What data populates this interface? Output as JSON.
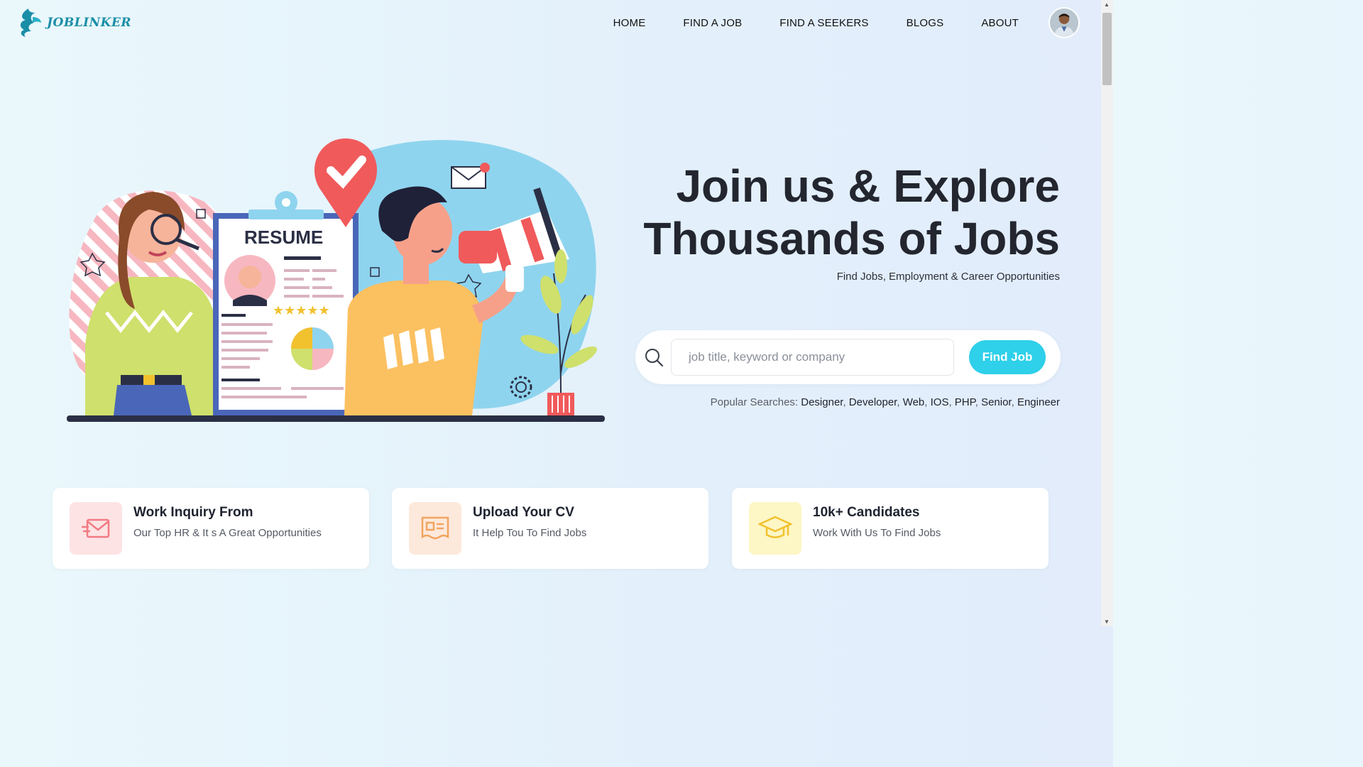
{
  "brand": {
    "name": "JOBLINKER",
    "accent": "#1a8ea6"
  },
  "nav": {
    "items": [
      {
        "label": "HOME"
      },
      {
        "label": "FIND A JOB"
      },
      {
        "label": "FIND A SEEKERS"
      },
      {
        "label": "BLOGS"
      },
      {
        "label": "ABOUT"
      }
    ]
  },
  "hero": {
    "title_line1": "Join us & Explore",
    "title_line2": "Thousands of Jobs",
    "subtitle": "Find Jobs, Employment & Career Opportunities",
    "illustration": {
      "resume_heading": "RESUME"
    }
  },
  "search": {
    "placeholder": "job title, keyword or company",
    "value": "",
    "button_label": "Find Job",
    "button_color": "#2ed0ea",
    "popular_label": "Popular Searches:",
    "popular_tags": [
      "Designer",
      "Developer",
      "Web",
      "IOS",
      "PHP",
      "Senior",
      "Engineer"
    ]
  },
  "features": [
    {
      "title": "Work Inquiry From",
      "desc": "Our Top HR & It s A Great Opportunities",
      "icon": "envelope-icon",
      "bg": "#fde3e4",
      "color": "#f27a82"
    },
    {
      "title": "Upload Your CV",
      "desc": "It Help Tou To Find Jobs",
      "icon": "cv-icon",
      "bg": "#fde9db",
      "color": "#f2a460"
    },
    {
      "title": "10k+ Candidates",
      "desc": "Work With Us To Find Jobs",
      "icon": "graduation-cap-icon",
      "bg": "#fdf6c5",
      "color": "#f2c12e"
    }
  ]
}
